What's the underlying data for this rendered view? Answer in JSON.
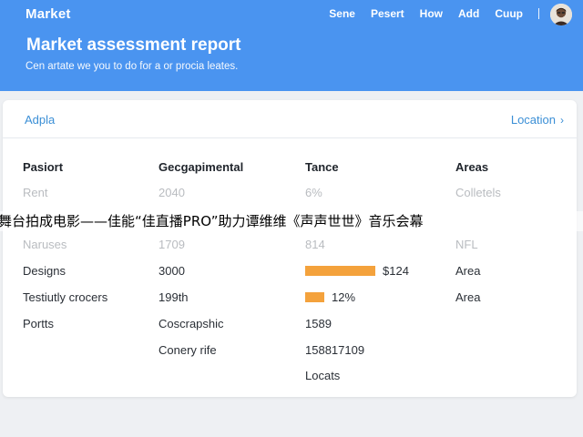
{
  "header": {
    "brand": "Market",
    "nav": [
      "Sene",
      "Pesert",
      "How",
      "Add",
      "Cuup"
    ],
    "title": "Market assessment report",
    "subtitle": "Cen artate we you to do for a or procia leates."
  },
  "card": {
    "tab": "Adpla",
    "link": "Location",
    "columns": [
      "Pasiort",
      "Gecgapimental",
      "Tance",
      "Areas"
    ],
    "rows": [
      [
        "Rent",
        "2040",
        "6%",
        "Colletels"
      ],
      [
        "",
        "",
        "",
        ""
      ],
      [
        "Naruses",
        "1709",
        "814",
        "NFL"
      ],
      [
        "Designs",
        "3000",
        "$124",
        "Area"
      ],
      [
        "Testiutly crocers",
        "199th",
        "12%",
        "Area"
      ],
      [
        "Portts",
        "Coscrapshic",
        "1589",
        ""
      ],
      [
        "",
        "Conery rife",
        "158817109",
        ""
      ],
      [
        "",
        "",
        "Locats",
        ""
      ]
    ],
    "bars": [
      0.9,
      0.25
    ]
  },
  "overlay_caption": "舞台拍成电影——佳能“佳直播PRO”助力谭维维《声声世世》音乐会幕",
  "colors": {
    "header": "#4a94f0",
    "accent": "#3b8fd6",
    "bar": "#f4a23c"
  },
  "icons": {
    "link_chevron": "chevron-right-icon"
  }
}
